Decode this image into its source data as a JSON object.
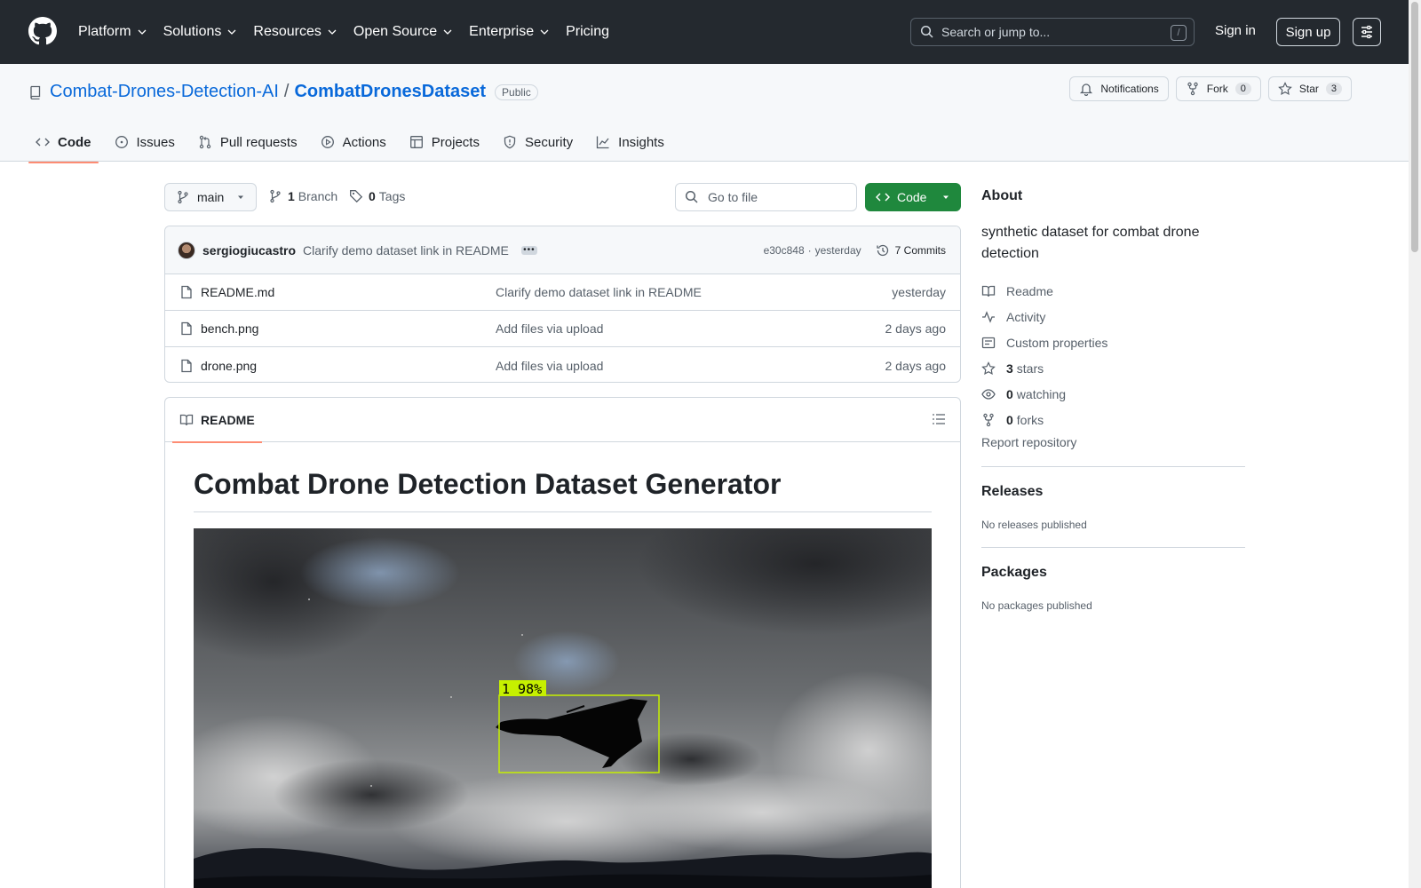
{
  "topnav": {
    "items": [
      {
        "label": "Platform",
        "has_menu": true
      },
      {
        "label": "Solutions",
        "has_menu": true
      },
      {
        "label": "Resources",
        "has_menu": true
      },
      {
        "label": "Open Source",
        "has_menu": true
      },
      {
        "label": "Enterprise",
        "has_menu": true
      },
      {
        "label": "Pricing",
        "has_menu": false
      }
    ],
    "search_placeholder": "Search or jump to...",
    "search_shortcut": "/",
    "signin": "Sign in",
    "signup": "Sign up"
  },
  "repo": {
    "owner": "Combat-Drones-Detection-AI",
    "separator": "/",
    "name": "CombatDronesDataset",
    "visibility": "Public",
    "notifications": "Notifications",
    "fork_label": "Fork",
    "fork_count": "0",
    "star_label": "Star",
    "star_count": "3"
  },
  "tabs": [
    {
      "label": "Code",
      "icon": "code-icon",
      "active": true
    },
    {
      "label": "Issues",
      "icon": "issue-icon"
    },
    {
      "label": "Pull requests",
      "icon": "pull-request-icon"
    },
    {
      "label": "Actions",
      "icon": "play-icon"
    },
    {
      "label": "Projects",
      "icon": "table-icon"
    },
    {
      "label": "Security",
      "icon": "shield-icon"
    },
    {
      "label": "Insights",
      "icon": "graph-icon"
    }
  ],
  "toolbar": {
    "branch": "main",
    "branch_count": "1",
    "branch_label": "Branch",
    "tag_count": "0",
    "tag_label": "Tags",
    "goto_placeholder": "Go to file",
    "code_button": "Code"
  },
  "commit": {
    "author": "sergiogiucastro",
    "message": "Clarify demo dataset link in README",
    "hash": "e30c848",
    "sep": "·",
    "time": "yesterday",
    "commits_label": "7 Commits"
  },
  "files": [
    {
      "name": "README.md",
      "message": "Clarify demo dataset link in README",
      "date": "yesterday"
    },
    {
      "name": "bench.png",
      "message": "Add files via upload",
      "date": "2 days ago"
    },
    {
      "name": "drone.png",
      "message": "Add files via upload",
      "date": "2 days ago"
    }
  ],
  "readme": {
    "tab_label": "README",
    "title": "Combat Drone Detection Dataset Generator",
    "detection_label": "1 98%"
  },
  "about": {
    "heading": "About",
    "description": "synthetic dataset for combat drone detection",
    "items": [
      {
        "icon": "book-icon",
        "label": "Readme",
        "count": ""
      },
      {
        "icon": "pulse-icon",
        "label": "Activity",
        "count": ""
      },
      {
        "icon": "note-icon",
        "label": "Custom properties",
        "count": ""
      },
      {
        "icon": "star-icon",
        "label": "stars",
        "count": "3"
      },
      {
        "icon": "eye-icon",
        "label": "watching",
        "count": "0"
      },
      {
        "icon": "fork-icon",
        "label": "forks",
        "count": "0"
      }
    ],
    "report": "Report repository"
  },
  "releases": {
    "heading": "Releases",
    "empty": "No releases published"
  },
  "packages": {
    "heading": "Packages",
    "empty": "No packages published"
  },
  "colors": {
    "header_bg": "#24292f",
    "link": "#0969da",
    "primary_button": "#1f883d",
    "tab_underline": "#fd8c73",
    "detection_box": "#c6f000"
  }
}
